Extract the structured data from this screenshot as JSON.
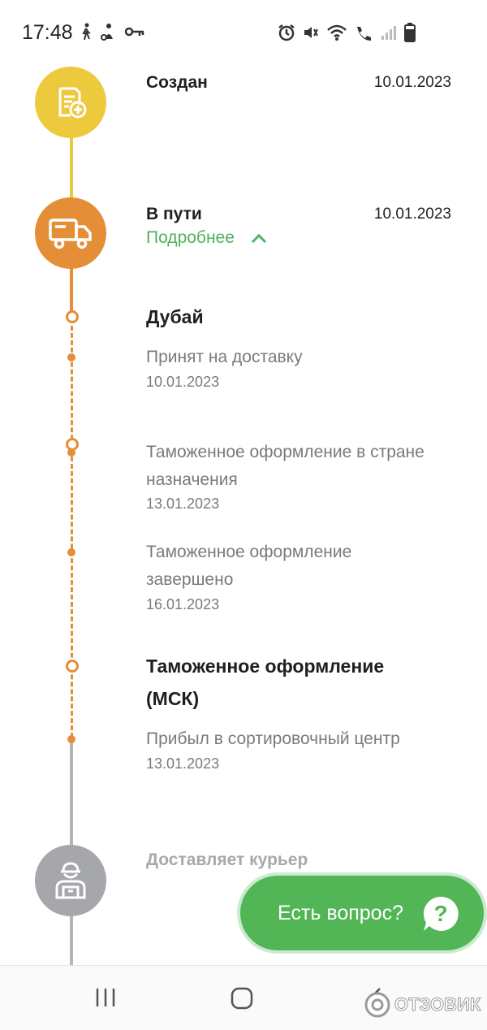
{
  "status_bar": {
    "time": "17:48"
  },
  "stages": {
    "created": {
      "title": "Создан",
      "date": "10.01.2023",
      "icon": "document-add-icon",
      "color": "#ecc93d"
    },
    "in_transit": {
      "title": "В пути",
      "date": "10.01.2023",
      "icon": "truck-icon",
      "color": "#e48f38",
      "details_label": "Подробнее"
    },
    "courier": {
      "title": "Доставляет курьер",
      "icon": "courier-icon",
      "color": "#a6a7ab"
    }
  },
  "locations": [
    {
      "name": "Дубай",
      "events": [
        {
          "text": "Принят на доставку",
          "date": "10.01.2023"
        },
        {
          "text": "Таможенное оформление в стране назначения",
          "date": "13.01.2023"
        },
        {
          "text": "Таможенное оформление завершено",
          "date": "16.01.2023"
        }
      ]
    },
    {
      "name": "Таможенное оформление (МСК)",
      "events": [
        {
          "text": "Прибыл в сортировочный центр",
          "date": "13.01.2023"
        }
      ]
    }
  ],
  "help_button": {
    "label": "Есть вопрос?",
    "icon": "question-chat-icon",
    "color": "#52b656"
  },
  "watermark": {
    "text": "ОТЗОВИК"
  }
}
